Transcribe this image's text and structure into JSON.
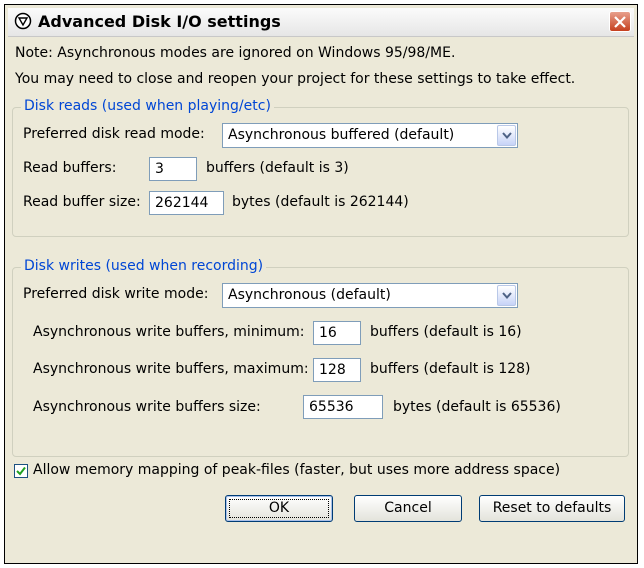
{
  "window": {
    "title": "Advanced Disk I/O settings"
  },
  "notes": {
    "line1": "Note: Asynchronous modes are ignored on Windows 95/98/ME.",
    "line2": "You may need to close and reopen your project for these settings to take effect."
  },
  "disk_reads": {
    "legend": "Disk reads (used when playing/etc)",
    "read_mode_label": "Preferred disk read mode:",
    "read_mode_value": "Asynchronous buffered (default)",
    "read_buffers_label": "Read buffers:",
    "read_buffers_value": "3",
    "read_buffers_hint": "buffers (default is 3)",
    "buffer_size_label": "Read buffer size:",
    "buffer_size_value": "262144",
    "buffer_size_hint": "bytes (default is 262144)"
  },
  "disk_writes": {
    "legend": "Disk writes (used when recording)",
    "write_mode_label": "Preferred disk write mode:",
    "write_mode_value": "Asynchronous (default)",
    "min_label": "Asynchronous write buffers, minimum:",
    "min_value": "16",
    "min_hint": "buffers (default is 16)",
    "max_label": "Asynchronous write buffers, maximum:",
    "max_value": "128",
    "max_hint": "buffers (default is 128)",
    "size_label": "Asynchronous write buffers size:",
    "size_value": "65536",
    "size_hint": "bytes (default is 65536)"
  },
  "memory_mapping": {
    "label": "Allow memory mapping of peak-files (faster, but uses more address space)",
    "checked": true
  },
  "buttons": {
    "ok": "OK",
    "cancel": "Cancel",
    "reset": "Reset to defaults"
  },
  "colors": {
    "group_legend": "#0046d5",
    "dialog_bg": "#ece9d8",
    "close_button": "#c5401f"
  }
}
